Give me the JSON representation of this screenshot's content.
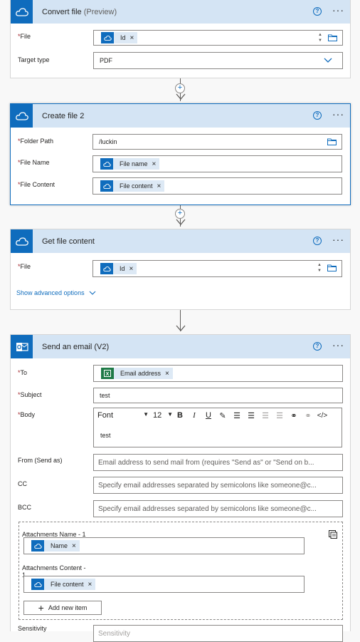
{
  "cards": {
    "convert": {
      "title": "Convert file",
      "title_suffix": "(Preview)",
      "file_label": "File",
      "file_token": "Id",
      "target_label": "Target type",
      "target_value": "PDF"
    },
    "create": {
      "title": "Create file 2",
      "folder_label": "Folder Path",
      "folder_value": "/luckin",
      "name_label": "File Name",
      "name_token": "File name",
      "content_label": "File Content",
      "content_token": "File content"
    },
    "getcontent": {
      "title": "Get file content",
      "file_label": "File",
      "file_token": "Id",
      "advanced_link": "Show advanced options"
    },
    "email": {
      "title": "Send an email (V2)",
      "to_label": "To",
      "to_token": "Email address",
      "subject_label": "Subject",
      "subject_value": "test",
      "body_label": "Body",
      "font_value": "Font",
      "size_value": "12",
      "body_value": "test",
      "from_label": "From (Send as)",
      "from_placeholder": "Email address to send mail from (requires \"Send as\" or \"Send on b...",
      "cc_label": "CC",
      "cc_placeholder": "Specify email addresses separated by semicolons like someone@c...",
      "bcc_label": "BCC",
      "bcc_placeholder": "Specify email addresses separated by semicolons like someone@c...",
      "att_name_label": "Attachments Name - 1",
      "att_name_token": "Name",
      "att_content_label": "Attachments Content -",
      "att_content_label2": "1",
      "att_content_token": "File content",
      "add_item": "Add new item",
      "sensitivity_label": "Sensitivity",
      "sensitivity_placeholder": "Sensitivity"
    }
  },
  "common": {
    "required_mark": "*",
    "remove": "×",
    "help": "?",
    "more": "···"
  },
  "colors": {
    "accent": "#0f6cbd",
    "header_bg": "#d4e4f4",
    "excel": "#1f7a47",
    "required": "#a4262c"
  }
}
